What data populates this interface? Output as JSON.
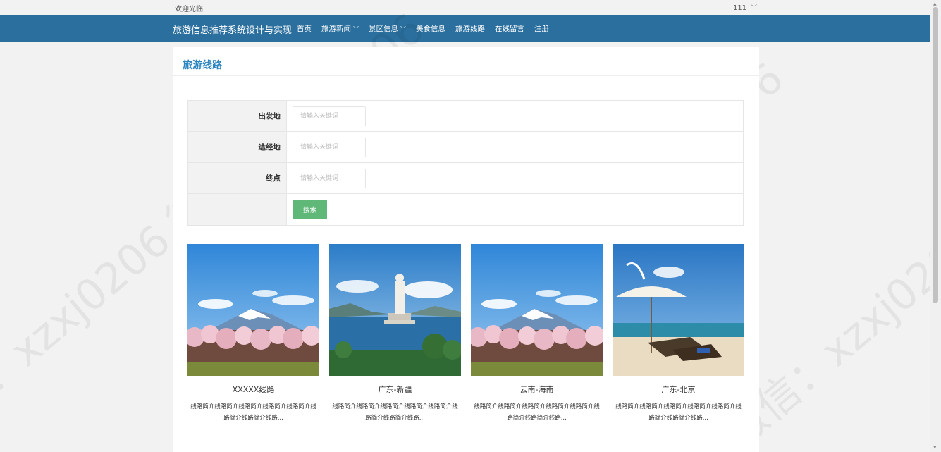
{
  "topbar": {
    "welcome": "欢迎光临",
    "user": "111",
    "chevron": "﹀"
  },
  "navbar": {
    "brand": "旅游信息推荐系统设计与实现",
    "items": [
      {
        "label": "首页"
      },
      {
        "label": "旅游新闻",
        "dropdown": true
      },
      {
        "label": "景区信息",
        "dropdown": true
      },
      {
        "label": "美食信息"
      },
      {
        "label": "旅游线路"
      },
      {
        "label": "在线留言"
      },
      {
        "label": "注册"
      }
    ]
  },
  "page": {
    "title": "旅游线路"
  },
  "search": {
    "departure_label": "出发地",
    "waypoint_label": "途经地",
    "destination_label": "终点",
    "placeholder": "请输入关键词",
    "button": "搜索"
  },
  "routes": [
    {
      "name": "XXXXX线路",
      "image": "mount-fuji-cherry-blossom",
      "desc": "线路简介线路简介线路简介线路简介线路简介线路简介线路简介线路..."
    },
    {
      "name": "广东-新疆",
      "image": "guanyin-statue-sea",
      "desc": "线路简介线路简介线路简介线路简介线路简介线路简介线路简介线路..."
    },
    {
      "name": "云南-海南",
      "image": "mount-fuji-cherry-blossom",
      "desc": "线路简介线路简介线路简介线路简介线路简介线路简介线路简介线路..."
    },
    {
      "name": "广东-北京",
      "image": "beach-umbrella-loungers",
      "desc": "线路简介线路简介线路简介线路简介线路简介线路简介线路简介线路..."
    }
  ],
  "watermark": "微信：xzxj0206",
  "colors": {
    "navbar": "#2a6f9e",
    "title": "#2e86c1",
    "search_button": "#5fb878"
  }
}
